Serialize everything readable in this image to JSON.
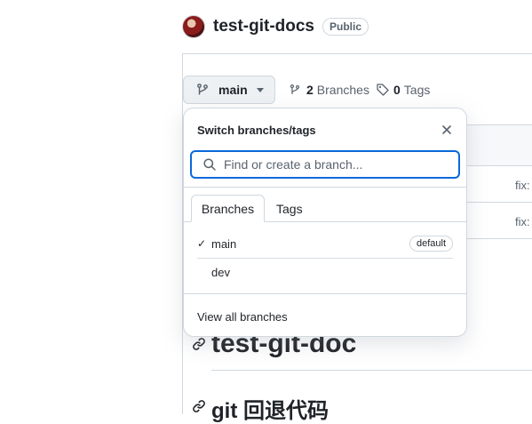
{
  "repo": {
    "name": "test-git-docs",
    "visibility": "Public"
  },
  "branch_button": {
    "label": "main"
  },
  "stats": {
    "branches_count": "2",
    "branches_label": "Branches",
    "tags_count": "0",
    "tags_label": "Tags"
  },
  "background": {
    "row1_text": "fix:",
    "row2_text": "fix:",
    "heading1": "test-git-doc",
    "heading2": "git 回退代码"
  },
  "popover": {
    "title": "Switch branches/tags",
    "search_placeholder": "Find or create a branch...",
    "tabs": [
      {
        "label": "Branches",
        "active": true
      },
      {
        "label": "Tags",
        "active": false
      }
    ],
    "branches": [
      {
        "name": "main",
        "selected": true,
        "badge": "default"
      },
      {
        "name": "dev",
        "selected": false,
        "badge": ""
      }
    ],
    "view_all": "View all branches"
  },
  "colors": {
    "accent": "#0969da",
    "text": "#1f2328",
    "muted": "#59636e",
    "border": "#d0d7de"
  },
  "icons": [
    "avatar",
    "git-branch-icon",
    "caret-down-icon",
    "tag-icon",
    "close-icon",
    "search-icon",
    "check-icon",
    "link-icon"
  ]
}
